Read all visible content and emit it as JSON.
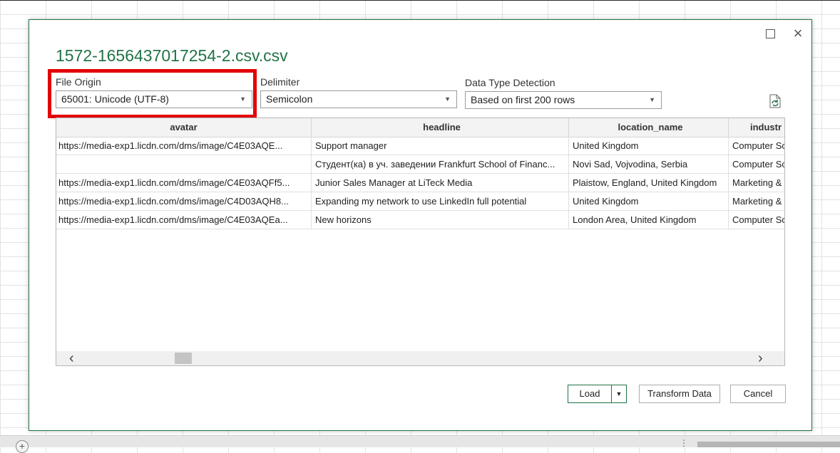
{
  "dialog": {
    "title": "1572-1656437017254-2.csv.csv",
    "window_controls": {
      "maximize": "maximize-icon",
      "close": "×"
    }
  },
  "file_origin": {
    "label": "File Origin",
    "value": "65001: Unicode (UTF-8)"
  },
  "delimiter": {
    "label": "Delimiter",
    "value": "Semicolon"
  },
  "data_type_detection": {
    "label": "Data Type Detection",
    "value": "Based on first 200 rows"
  },
  "preview": {
    "columns": [
      "avatar",
      "headline",
      "location_name",
      "industr"
    ],
    "rows": [
      [
        "https://media-exp1.licdn.com/dms/image/C4E03AQE...",
        "Support manager",
        "United Kingdom",
        "Computer Sc"
      ],
      [
        "",
        "Студент(ка) в уч. заведении Frankfurt School of Financ...",
        "Novi Sad, Vojvodina, Serbia",
        "Computer Sc"
      ],
      [
        "https://media-exp1.licdn.com/dms/image/C4E03AQFf5...",
        "Junior Sales Manager at LiTeck Media",
        "Plaistow, England, United Kingdom",
        "Marketing &"
      ],
      [
        "https://media-exp1.licdn.com/dms/image/C4D03AQH8...",
        "Expanding my network to use LinkedIn full potential",
        "United Kingdom",
        "Marketing &"
      ],
      [
        "https://media-exp1.licdn.com/dms/image/C4E03AQEa...",
        "New horizons",
        "London Area, United Kingdom",
        "Computer Sc"
      ]
    ]
  },
  "buttons": {
    "load": "Load",
    "transform": "Transform Data",
    "cancel": "Cancel"
  },
  "colors": {
    "accent": "#217346",
    "highlight": "#e30000"
  }
}
